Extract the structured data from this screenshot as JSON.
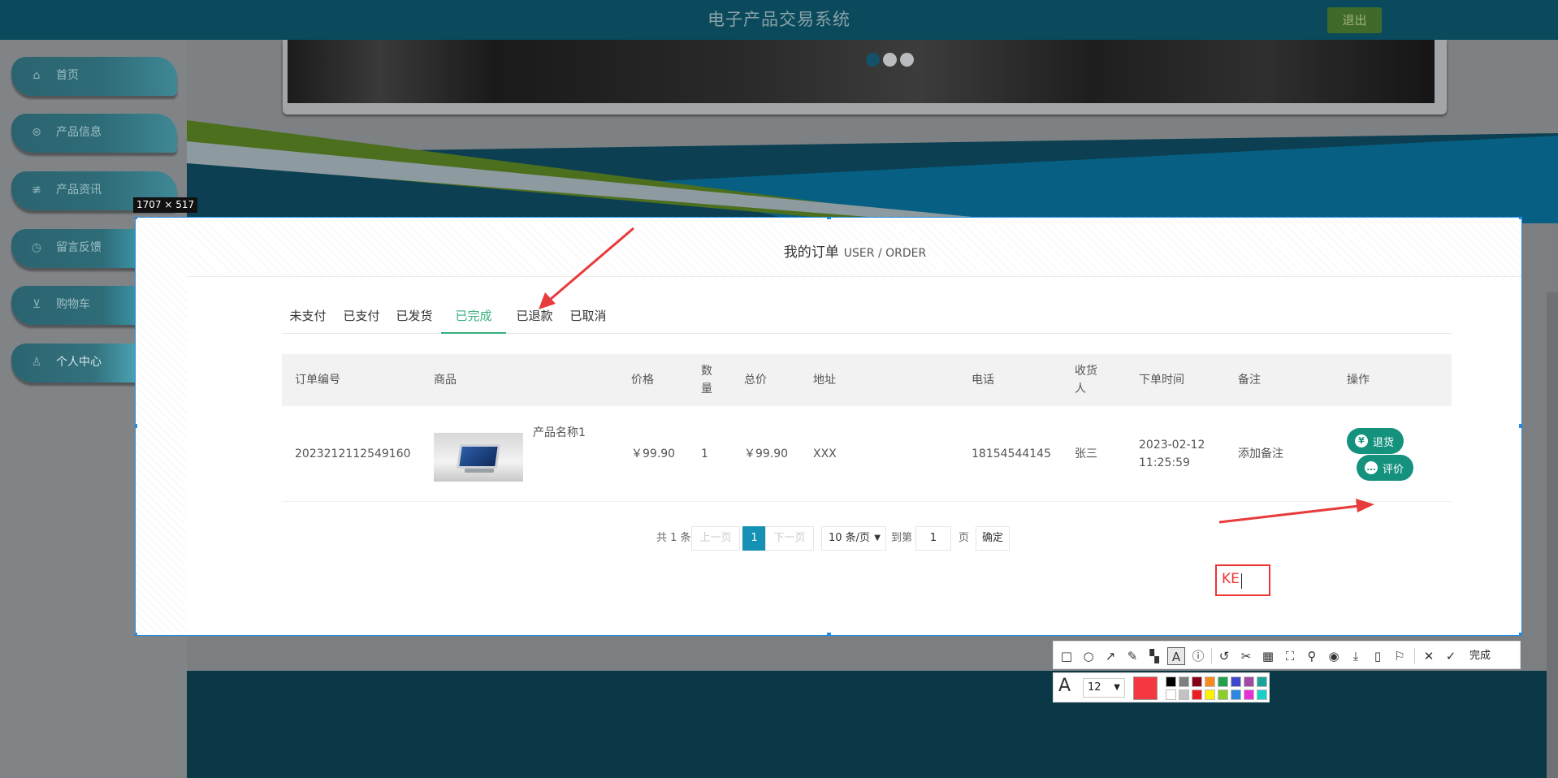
{
  "app": {
    "title": "电子产品交易系统",
    "logout_label": "退出"
  },
  "sidebar": {
    "items": [
      {
        "label": "首页",
        "icon": "home-icon"
      },
      {
        "label": "产品信息",
        "icon": "product-icon"
      },
      {
        "label": "产品资讯",
        "icon": "news-icon"
      },
      {
        "label": "留言反馈",
        "icon": "feedback-icon"
      },
      {
        "label": "购物车",
        "icon": "cart-icon"
      },
      {
        "label": "个人中心",
        "icon": "user-icon"
      }
    ]
  },
  "selection_tool": {
    "size_label": "1707 × 517"
  },
  "orders": {
    "title": "我的订单",
    "subtitle": "USER / ORDER",
    "tabs": [
      "未支付",
      "已支付",
      "已发货",
      "已完成",
      "已退款",
      "已取消"
    ],
    "active_tab": "已完成",
    "columns": [
      "订单编号",
      "商品",
      "价格",
      "数量",
      "总价",
      "地址",
      "电话",
      "收货人",
      "下单时间",
      "备注",
      "操作"
    ],
    "rows": [
      {
        "order_no": "2023212112549160",
        "product_name": "产品名称1",
        "price": "￥99.90",
        "quantity": "1",
        "total": "￥99.90",
        "address": "XXX",
        "phone": "18154544145",
        "receiver": "张三",
        "order_time": "2023-02-12 11:25:59",
        "remark": "添加备注",
        "actions": [
          {
            "label": "退货",
            "icon": "yen-icon"
          },
          {
            "label": "评价",
            "icon": "comment-icon"
          }
        ]
      }
    ],
    "pagination": {
      "total_text": "共 1 条",
      "prev_label": "上一页",
      "current_page": "1",
      "next_label": "下一页",
      "page_size_option": "10 条/页",
      "goto_label": "到第",
      "goto_value": "1",
      "page_unit": "页",
      "confirm_label": "确定"
    }
  },
  "annotation": {
    "text": "KE",
    "color": "#e33333"
  },
  "toolbar": {
    "tools": [
      "rectangle-icon",
      "ellipse-icon",
      "arrow-icon",
      "pen-icon",
      "mosaic-icon",
      "text-icon",
      "number-icon",
      "undo-icon",
      "cut-icon",
      "ocr-icon",
      "scroll-capture-icon",
      "pin-icon",
      "record-icon",
      "download-icon",
      "phone-icon",
      "bookmark-icon",
      "close-icon",
      "check-icon"
    ],
    "done_label": "完成",
    "font_size": "12",
    "current_color": "#f3393f",
    "palette": [
      "#000000",
      "#7f7f7f",
      "#880015",
      "#f78b20",
      "#22a14c",
      "#3f48cc",
      "#a349a4",
      "#1aa39a",
      "#ffffff",
      "#c3c3c3",
      "#ed1c24",
      "#fff200",
      "#8ccf26",
      "#2f86e0",
      "#e632d4",
      "#18d0c8"
    ]
  }
}
